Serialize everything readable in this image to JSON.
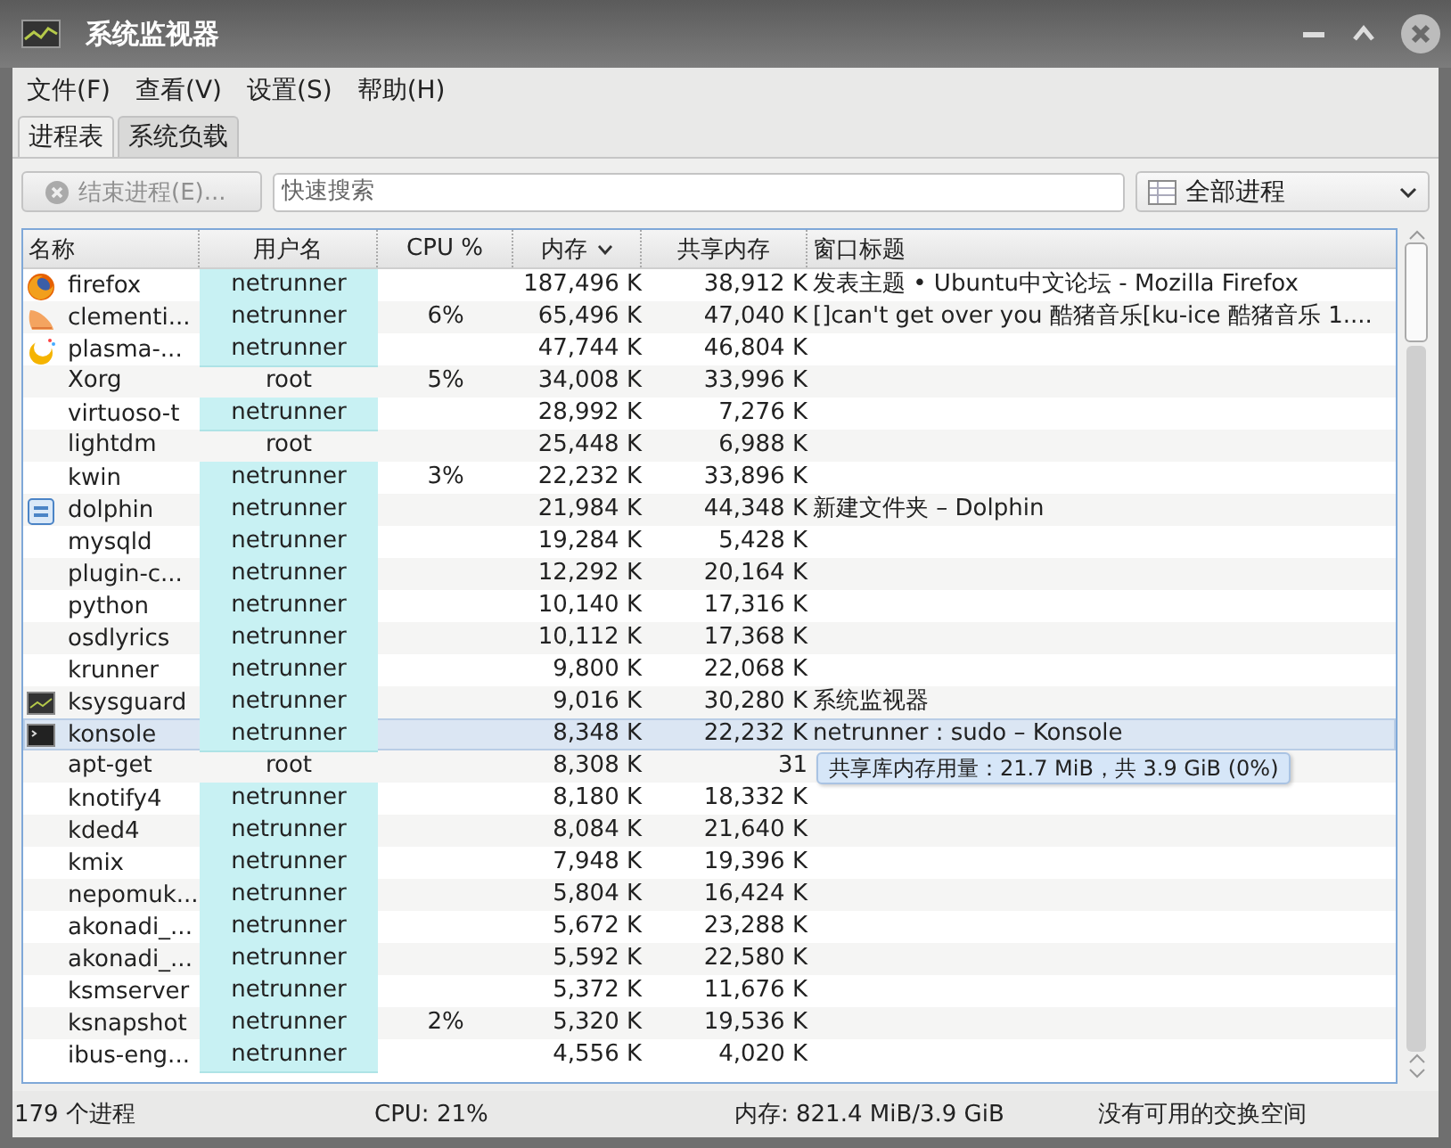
{
  "window": {
    "title": "系统监视器"
  },
  "menu": [
    "文件(F)",
    "查看(V)",
    "设置(S)",
    "帮助(H)"
  ],
  "tabs": [
    {
      "label": "进程表",
      "selected": true
    },
    {
      "label": "系统负载",
      "selected": false
    }
  ],
  "toolbar": {
    "end_button": {
      "label": "结束进程(E)...",
      "disabled": true
    },
    "search": {
      "placeholder": "快速搜索"
    },
    "filter": {
      "value": "全部进程"
    }
  },
  "table": {
    "columns": [
      {
        "label": "名称",
        "sorted": false
      },
      {
        "label": "用户名",
        "sorted": false
      },
      {
        "label": "CPU %",
        "sorted": false
      },
      {
        "label": "内存",
        "sorted": true
      },
      {
        "label": "共享内存",
        "sorted": false
      },
      {
        "label": "窗口标题",
        "sorted": false
      }
    ],
    "rows": [
      {
        "kind": "firefox",
        "name": "firefox",
        "user": "netrunner",
        "own": true,
        "cpu": "",
        "mem": "187,496 K",
        "shared": "38,912 K",
        "title": "发表主题 • Ubuntu中文论坛 - Mozilla Firefox",
        "selected": false
      },
      {
        "kind": "clementine",
        "name": "clementi...",
        "user": "netrunner",
        "own": true,
        "cpu": "6%",
        "mem": "65,496 K",
        "shared": "47,040 K",
        "title": "[]can't get over you 酷猪音乐[ku-ice 酷猪音乐 1....",
        "selected": false
      },
      {
        "kind": "plasma",
        "name": "plasma-...",
        "user": "netrunner",
        "own": true,
        "cpu": "",
        "mem": "47,744 K",
        "shared": "46,804 K",
        "title": "",
        "selected": false
      },
      {
        "kind": "none",
        "name": "Xorg",
        "user": "root",
        "own": false,
        "cpu": "5%",
        "mem": "34,008 K",
        "shared": "33,996 K",
        "title": "",
        "selected": false
      },
      {
        "kind": "none",
        "name": "virtuoso-t",
        "user": "netrunner",
        "own": true,
        "cpu": "",
        "mem": "28,992 K",
        "shared": "7,276 K",
        "title": "",
        "selected": false
      },
      {
        "kind": "none",
        "name": "lightdm",
        "user": "root",
        "own": false,
        "cpu": "",
        "mem": "25,448 K",
        "shared": "6,988 K",
        "title": "",
        "selected": false
      },
      {
        "kind": "none",
        "name": "kwin",
        "user": "netrunner",
        "own": true,
        "cpu": "3%",
        "mem": "22,232 K",
        "shared": "33,896 K",
        "title": "",
        "selected": false
      },
      {
        "kind": "dolphin",
        "name": "dolphin",
        "user": "netrunner",
        "own": true,
        "cpu": "",
        "mem": "21,984 K",
        "shared": "44,348 K",
        "title": "新建文件夹 – Dolphin",
        "selected": false
      },
      {
        "kind": "none",
        "name": "mysqld",
        "user": "netrunner",
        "own": true,
        "cpu": "",
        "mem": "19,284 K",
        "shared": "5,428 K",
        "title": "",
        "selected": false
      },
      {
        "kind": "none",
        "name": "plugin-c...",
        "user": "netrunner",
        "own": true,
        "cpu": "",
        "mem": "12,292 K",
        "shared": "20,164 K",
        "title": "",
        "selected": false
      },
      {
        "kind": "none",
        "name": "python",
        "user": "netrunner",
        "own": true,
        "cpu": "",
        "mem": "10,140 K",
        "shared": "17,316 K",
        "title": "",
        "selected": false
      },
      {
        "kind": "none",
        "name": "osdlyrics",
        "user": "netrunner",
        "own": true,
        "cpu": "",
        "mem": "10,112 K",
        "shared": "17,368 K",
        "title": "",
        "selected": false
      },
      {
        "kind": "none",
        "name": "krunner",
        "user": "netrunner",
        "own": true,
        "cpu": "",
        "mem": "9,800 K",
        "shared": "22,068 K",
        "title": "",
        "selected": false
      },
      {
        "kind": "monitor",
        "name": "ksysguard",
        "user": "netrunner",
        "own": true,
        "cpu": "",
        "mem": "9,016 K",
        "shared": "30,280 K",
        "title": "系统监视器",
        "selected": false
      },
      {
        "kind": "terminal",
        "name": "konsole",
        "user": "netrunner",
        "own": true,
        "cpu": "",
        "mem": "8,348 K",
        "shared": "22,232 K",
        "title": "netrunner : sudo – Konsole",
        "selected": true
      },
      {
        "kind": "none",
        "name": "apt-get",
        "user": "root",
        "own": false,
        "cpu": "",
        "mem": "8,308 K",
        "shared": "31",
        "title": "",
        "selected": false
      },
      {
        "kind": "none",
        "name": "knotify4",
        "user": "netrunner",
        "own": true,
        "cpu": "",
        "mem": "8,180 K",
        "shared": "18,332 K",
        "title": "",
        "selected": false
      },
      {
        "kind": "none",
        "name": "kded4",
        "user": "netrunner",
        "own": true,
        "cpu": "",
        "mem": "8,084 K",
        "shared": "21,640 K",
        "title": "",
        "selected": false
      },
      {
        "kind": "none",
        "name": "kmix",
        "user": "netrunner",
        "own": true,
        "cpu": "",
        "mem": "7,948 K",
        "shared": "19,396 K",
        "title": "",
        "selected": false
      },
      {
        "kind": "none",
        "name": "nepomuk...",
        "user": "netrunner",
        "own": true,
        "cpu": "",
        "mem": "5,804 K",
        "shared": "16,424 K",
        "title": "",
        "selected": false
      },
      {
        "kind": "none",
        "name": "akonadi_...",
        "user": "netrunner",
        "own": true,
        "cpu": "",
        "mem": "5,672 K",
        "shared": "23,288 K",
        "title": "",
        "selected": false
      },
      {
        "kind": "none",
        "name": "akonadi_...",
        "user": "netrunner",
        "own": true,
        "cpu": "",
        "mem": "5,592 K",
        "shared": "22,580 K",
        "title": "",
        "selected": false
      },
      {
        "kind": "none",
        "name": "ksmserver",
        "user": "netrunner",
        "own": true,
        "cpu": "",
        "mem": "5,372 K",
        "shared": "11,676 K",
        "title": "",
        "selected": false
      },
      {
        "kind": "none",
        "name": "ksnapshot",
        "user": "netrunner",
        "own": true,
        "cpu": "2%",
        "mem": "5,320 K",
        "shared": "19,536 K",
        "title": "",
        "selected": false
      },
      {
        "kind": "none",
        "name": "ibus-eng...",
        "user": "netrunner",
        "own": true,
        "cpu": "",
        "mem": "4,556 K",
        "shared": "4,020 K",
        "title": "",
        "selected": false
      }
    ]
  },
  "tooltip": "共享库内存用量：21.7 MiB，共 3.9 GiB (0%)",
  "status_bar": [
    "179 个进程",
    "CPU: 21%",
    "内存: 821.4 MiB/3.9 GiB",
    "没有可用的交换空间"
  ]
}
